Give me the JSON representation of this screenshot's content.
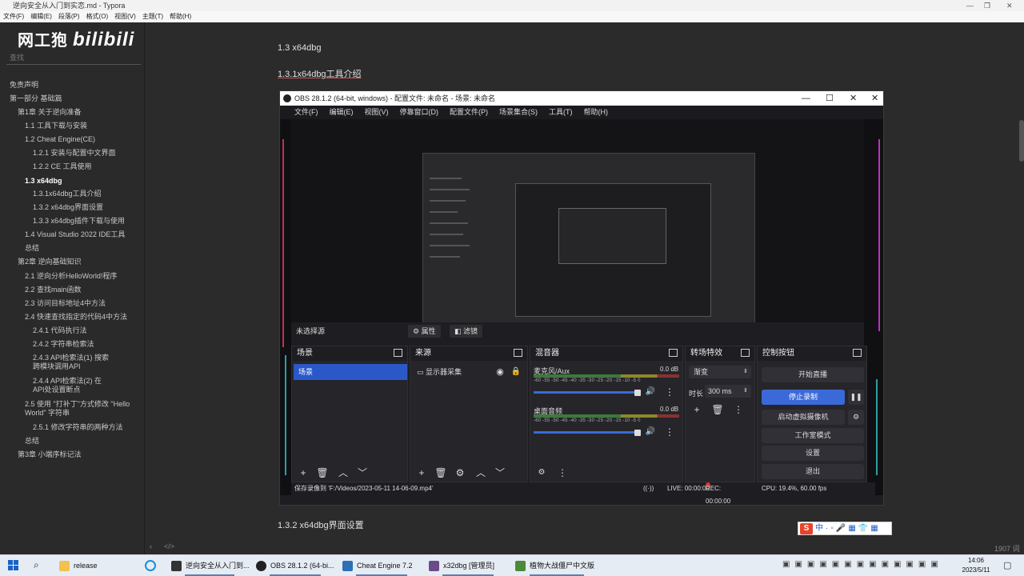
{
  "typora": {
    "title": "逆向安全从入门到实恋.md - Typora",
    "menu": [
      "文件(F)",
      "编辑(E)",
      "段落(P)",
      "格式(O)",
      "视图(V)",
      "主题(T)",
      "帮助(H)"
    ],
    "logo_text": "网工狍",
    "logo_brand": "bilibili",
    "search_placeholder": "查找",
    "toc": [
      "免责声明",
      "第一部分 基础篇",
      "第1章 关于逆向准备",
      "1.1 工具下载与安装",
      "1.2 Cheat Engine(CE)",
      "1.2.1 安装与配置中文界面",
      "1.2.2 CE 工具使用",
      "1.3 x64dbg",
      "1.3.1x64dbg工具介绍",
      "1.3.2 x64dbg界面设置",
      "1.3.3 x64dbg插件下载与使用",
      "1.4 Visual Studio 2022 IDE工具",
      "总结",
      "第2章 逆向基础知识",
      "2.1 逆向分析HelloWorld!程序",
      "2.2 查找main函数",
      "2.3 访问目标地址4中方法",
      "2.4 快速查找指定的代码4中方法",
      "2.4.1 代码执行法",
      "2.4.2 字符串检索法",
      "2.4.3 API检索法(1) 搜索跨模块调用API",
      "2.4.4 API检索法(2) 在API处设置断点",
      "2.5 使用 \"打补丁\"方式修改 \"Hello World\" 字符串",
      "2.5.1 修改字符串的两种方法",
      "总结",
      "第3章 小端序标记法"
    ],
    "doc_h1": "1.3 x64dbg",
    "doc_h2": "1.3.1x64dbg工具介绍",
    "doc_h3": "1.3.2 x64dbg界面设置",
    "word_count": "1907 词"
  },
  "obs": {
    "title": "OBS 28.1.2 (64-bit, windows) - 配置文件: 未命名 - 场景: 未命名",
    "menu": [
      "文件(F)",
      "编辑(E)",
      "视图(V)",
      "停靠窗口(D)",
      "配置文件(P)",
      "场景集合(S)",
      "工具(T)",
      "帮助(H)"
    ],
    "no_source": "未选择源",
    "properties": "属性",
    "filters": "滤镜",
    "docks": {
      "scenes": "场景",
      "sources": "来源",
      "mixer": "混音器",
      "transitions": "转场特效",
      "controls": "控制按钮"
    },
    "scene_item": "场景",
    "source_item": "显示器采集",
    "mixer_channels": [
      {
        "name": "麦克风/Aux",
        "db": "0.0 dB"
      },
      {
        "name": "桌面音频",
        "db": "0.0 dB"
      }
    ],
    "meter_ticks": "-60 -55 -50 -45 -40 -35 -30 -25 -20 -15 -10 -5 0",
    "transition_type": "渐变",
    "duration_label": "时长",
    "duration_value": "300 ms",
    "controls": [
      "开始直播",
      "停止录制",
      "启动虚拟摄像机",
      "工作室模式",
      "设置",
      "退出"
    ],
    "status_saved": "保存录像到 'F:/Videos/2023-05-11 14-06-09.mp4'",
    "status_live": "LIVE: 00:00:00",
    "status_rec": "REC: 00:00:00",
    "status_cpu": "CPU: 19.4%, 60.00 fps"
  },
  "taskbar": {
    "items": [
      {
        "label": "release",
        "color": "#f2c14e"
      },
      {
        "label": "逆向安全从入门到...",
        "color": "#333333"
      },
      {
        "label": "OBS 28.1.2 (64-bi...",
        "color": "#222222"
      },
      {
        "label": "Cheat Engine 7.2",
        "color": "#2e6fb5"
      },
      {
        "label": "x32dbg [管理员]",
        "color": "#6a4a8a"
      },
      {
        "label": "植物大战僵尸中文版",
        "color": "#4a8a3a"
      }
    ],
    "time": "14:06",
    "date": "2023/5/11"
  },
  "colors": {
    "accent": "#3b6ad8",
    "obs_panel": "#25252a",
    "typora_bg": "#2b2b2b"
  }
}
